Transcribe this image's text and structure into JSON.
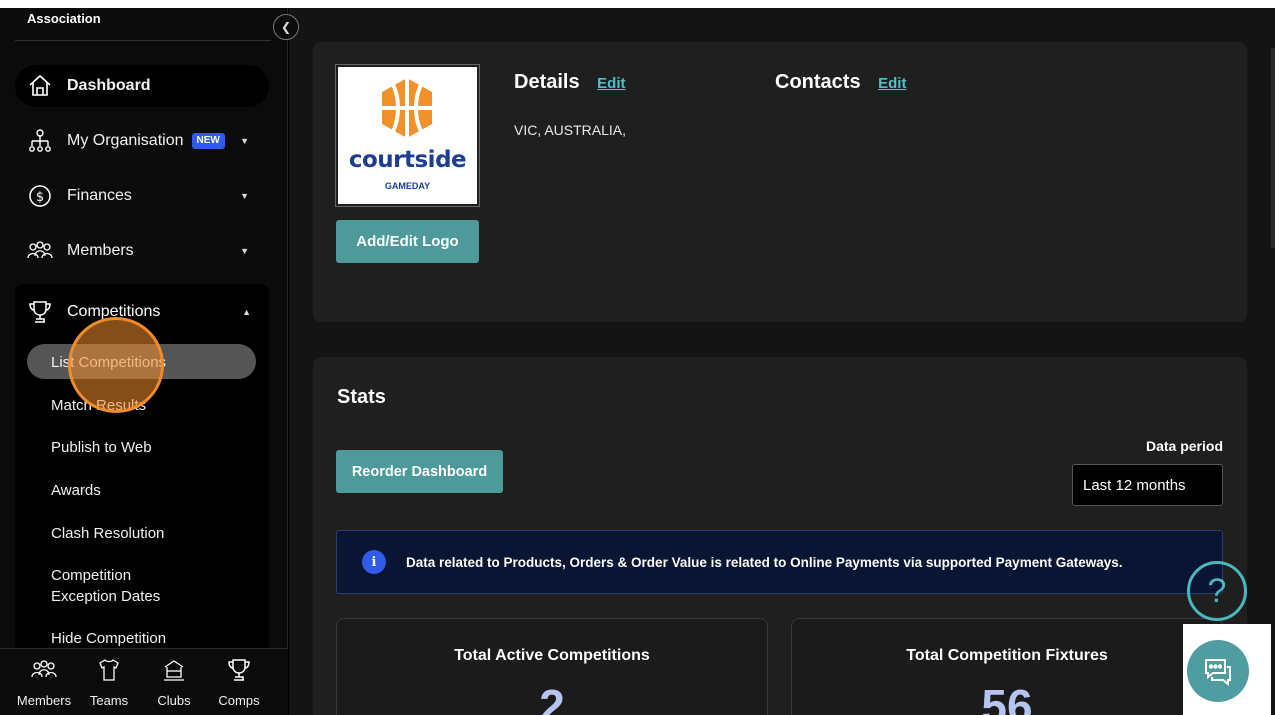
{
  "sidebar": {
    "org_name": "Association",
    "nav": {
      "dashboard": "Dashboard",
      "my_organisation": "My Organisation",
      "new_badge": "NEW",
      "finances": "Finances",
      "members": "Members",
      "competitions": "Competitions"
    },
    "competitions_sub": [
      "List Competitions",
      "Match Results",
      "Publish to Web",
      "Awards",
      "Clash Resolution",
      "Competition",
      "Exception Dates",
      "Hide Competition"
    ],
    "bottom_nav": [
      "Members",
      "Teams",
      "Clubs",
      "Comps"
    ]
  },
  "profile": {
    "logo_text": "courtside",
    "logo_sub": "GAMEDAY",
    "add_logo_button": "Add/Edit Logo",
    "details_title": "Details",
    "contacts_title": "Contacts",
    "edit_label": "Edit",
    "address": "VIC, AUSTRALIA,"
  },
  "stats": {
    "title": "Stats",
    "reorder_button": "Reorder Dashboard",
    "period_label": "Data period",
    "period_value": "Last 12 months",
    "info_text": "Data related to Products, Orders & Order Value is related to Online Payments via supported Payment Gateways.",
    "info_icon": "i",
    "cards": [
      {
        "title": "Total Active Competitions",
        "value": "2"
      },
      {
        "title": "Total Competition Fixtures",
        "value": "56"
      }
    ]
  },
  "help": {
    "glyph": "?"
  },
  "colors": {
    "accent_teal": "#4e9a9b",
    "brand_blue": "#2f5be8",
    "cursor_orange": "#f28c2b"
  }
}
